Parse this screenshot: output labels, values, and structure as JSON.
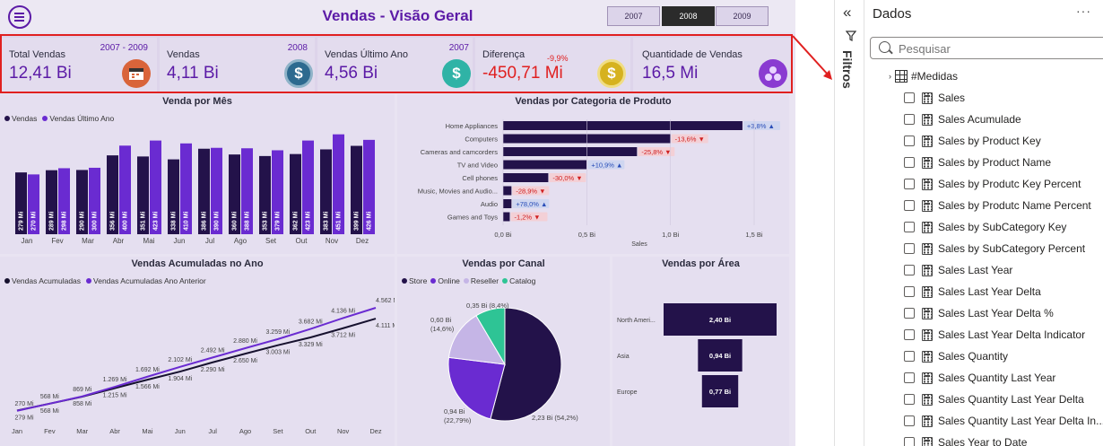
{
  "header": {
    "title": "Vendas - Visão Geral",
    "years": [
      "2007",
      "2008",
      "2009"
    ],
    "active_year": "2008"
  },
  "kpis": [
    {
      "label": "Total Vendas",
      "period": "2007 - 2009",
      "value": "12,41 Bi",
      "icon": "calendar-icon",
      "color": "#d9643a"
    },
    {
      "label": "Vendas",
      "period": "2008",
      "value": "4,11 Bi",
      "icon": "dollar-icon",
      "color": "#2d6a8f"
    },
    {
      "label": "Vendas Último Ano",
      "period": "2007",
      "value": "4,56 Bi",
      "icon": "dollar-arrows-icon",
      "color": "#2fb3a6"
    },
    {
      "label": "Diferença",
      "period": "-9,9%",
      "value": "-450,71 Mi",
      "icon": "coin-icon",
      "color": "#d6b21f",
      "value_color": "#e02020"
    },
    {
      "label": "Quantidade de Vendas",
      "period": "",
      "value": "16,5 Mi",
      "icon": "cluster-icon",
      "color": "#8a3bd1"
    }
  ],
  "charts": {
    "monthly": {
      "title": "Venda por Mês",
      "legend": [
        "Vendas",
        "Vendas Último Ano"
      ]
    },
    "category": {
      "title": "Vendas por Categoria de Produto",
      "xlabel": "Sales"
    },
    "cumulative": {
      "title": "Vendas Acumuladas no Ano",
      "legend": [
        "Vendas Acumuladas",
        "Vendas Acumuladas Ano Anterior"
      ]
    },
    "channel": {
      "title": "Vendas por Canal",
      "legend": [
        "Store",
        "Online",
        "Reseller",
        "Catalog"
      ]
    },
    "region": {
      "title": "Vendas por Área"
    }
  },
  "chart_data": [
    {
      "type": "bar",
      "title": "Venda por Mês",
      "categories": [
        "Jan",
        "Fev",
        "Mar",
        "Abr",
        "Mai",
        "Jun",
        "Jul",
        "Ago",
        "Set",
        "Out",
        "Nov",
        "Dez"
      ],
      "series": [
        {
          "name": "Vendas",
          "values": [
            279,
            289,
            290,
            356,
            351,
            338,
            386,
            360,
            353,
            362,
            383,
            399
          ],
          "labels": [
            "279 Mi",
            "289 Mi",
            "290 Mi",
            "356 Mi",
            "351 Mi",
            "338 Mi",
            "386 Mi",
            "360 Mi",
            "353 Mi",
            "362 Mi",
            "383 Mi",
            "399 Mi"
          ],
          "color": "#23124a"
        },
        {
          "name": "Vendas Último Ano",
          "values": [
            270,
            298,
            300,
            400,
            423,
            410,
            390,
            388,
            379,
            423,
            451,
            426
          ],
          "labels": [
            "270 Mi",
            "298 Mi",
            "300 Mi",
            "400 Mi",
            "423 Mi",
            "410 Mi",
            "390 Mi",
            "388 Mi",
            "379 Mi",
            "423 Mi",
            "451 Mi",
            "426 Mi"
          ],
          "color": "#6a2bd1"
        }
      ],
      "ylim": [
        0,
        470
      ]
    },
    {
      "type": "bar",
      "title": "Vendas por Categoria de Produto",
      "orientation": "horizontal",
      "categories": [
        "Home Appliances",
        "Computers",
        "Cameras and camcorders",
        "TV and Video",
        "Cell phones",
        "Music, Movies and Audio...",
        "Audio",
        "Games and Toys"
      ],
      "values": [
        1.43,
        1.0,
        0.8,
        0.5,
        0.27,
        0.05,
        0.05,
        0.04
      ],
      "deltas": [
        "+3,8%",
        "-13,6%",
        "-25,8%",
        "+10,9%",
        "-30,0%",
        "-28,9%",
        "+78,0%",
        "-1,2%"
      ],
      "delta_positive": [
        true,
        false,
        false,
        true,
        false,
        false,
        true,
        false
      ],
      "xticks": [
        "0,0 Bi",
        "0,5 Bi",
        "1,0 Bi",
        "1,5 Bi"
      ],
      "xlim": [
        0,
        1.5
      ],
      "xlabel": "Sales"
    },
    {
      "type": "line",
      "title": "Vendas Acumuladas no Ano",
      "x": [
        "Jan",
        "Fev",
        "Mar",
        "Abr",
        "Mai",
        "Jun",
        "Jul",
        "Ago",
        "Set",
        "Out",
        "Nov",
        "Dez"
      ],
      "series": [
        {
          "name": "Vendas Acumuladas",
          "values": [
            279,
            568,
            858,
            1215,
            1566,
            1904,
            2290,
            2650,
            3003,
            3329,
            3712,
            4111
          ],
          "labels": [
            "279 Mi",
            "568 Mi",
            "858 Mi",
            "1.215 Mi",
            "1.566 Mi",
            "1.904 Mi",
            "2.290 Mi",
            "2.650 Mi",
            "3.003 Mi",
            "3.329 Mi",
            "3.712 Mi",
            "4.111 Mi"
          ],
          "color": "#16112e"
        },
        {
          "name": "Vendas Acumuladas Ano Anterior",
          "values": [
            270,
            568,
            869,
            1269,
            1692,
            2102,
            2492,
            2880,
            3259,
            3682,
            4136,
            4562
          ],
          "labels": [
            "270 Mi",
            "568 Mi",
            "869 Mi",
            "1.269 Mi",
            "1.692 Mi",
            "2.102 Mi",
            "2.492 Mi",
            "2.880 Mi",
            "3.259 Mi",
            "3.682 Mi",
            "4.136 Mi",
            "4.562 Mi"
          ],
          "color": "#6a2bd1"
        }
      ]
    },
    {
      "type": "pie",
      "title": "Vendas por Canal",
      "categories": [
        "Store",
        "Online",
        "Reseller",
        "Catalog"
      ],
      "values": [
        2.23,
        0.94,
        0.6,
        0.35
      ],
      "labels": [
        "2,23 Bi (54,2%)",
        "0,94 Bi (22,79%)",
        "0,60 Bi (14,6%)",
        "0,35 Bi (8,4%)"
      ],
      "colors": [
        "#23124a",
        "#6a2bd1",
        "#c5b5e6",
        "#2ec495"
      ]
    },
    {
      "type": "bar",
      "title": "Vendas por Área",
      "orientation": "funnel",
      "categories": [
        "North Ameri...",
        "Asia",
        "Europe"
      ],
      "values": [
        2.4,
        0.94,
        0.77
      ],
      "labels": [
        "2,40 Bi",
        "0,94 Bi",
        "0,77 Bi"
      ]
    }
  ],
  "filters_pane": {
    "label": "Filtros"
  },
  "data_pane": {
    "title": "Dados",
    "more": "···",
    "search_placeholder": "Pesquisar",
    "table_name": "#Medidas",
    "fields": [
      "Sales",
      "Sales Acumulade",
      "Sales by Product Key",
      "Sales by Product Name",
      "Sales by Produtc Key Percent",
      "Sales by Produtc Name Percent",
      "Sales by SubCategory Key",
      "Sales by SubCategory Percent",
      "Sales Last Year",
      "Sales Last Year Delta",
      "Sales Last Year Delta %",
      "Sales Last Year Delta Indicator",
      "Sales Quantity",
      "Sales Quantity Last Year",
      "Sales Quantity Last Year Delta",
      "Sales Quantity Last Year Delta In...",
      "Sales Year to Date"
    ]
  }
}
